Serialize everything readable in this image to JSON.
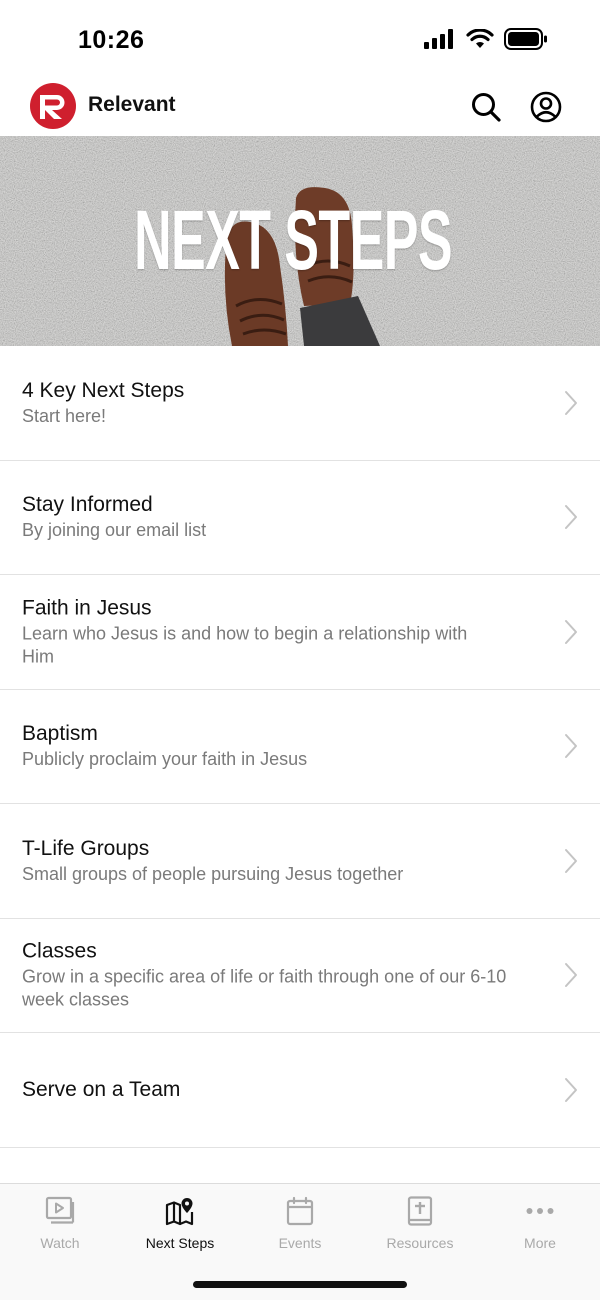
{
  "status_bar": {
    "time": "10:26"
  },
  "header": {
    "app_name": "Relevant",
    "logo_icon": "relevant-r-logo",
    "brand_color": "#cf1f2e",
    "search_icon": "search-icon",
    "profile_icon": "profile-icon"
  },
  "hero": {
    "title": "NEXT STEPS"
  },
  "list": {
    "items": [
      {
        "title": "4 Key Next Steps",
        "subtitle": "Start here!"
      },
      {
        "title": "Stay Informed",
        "subtitle": "By joining our email list"
      },
      {
        "title": "Faith in Jesus",
        "subtitle": "Learn who Jesus is and how to begin a relationship with Him"
      },
      {
        "title": "Baptism",
        "subtitle": "Publicly proclaim your faith in Jesus"
      },
      {
        "title": "T-Life Groups",
        "subtitle": "Small groups of people pursuing Jesus together"
      },
      {
        "title": "Classes",
        "subtitle": "Grow in a specific area of life or faith through one of our 6-10 week classes"
      },
      {
        "title": "Serve on a Team",
        "subtitle": ""
      }
    ]
  },
  "tab_bar": {
    "tabs": [
      {
        "label": "Watch",
        "icon": "play-icon",
        "active": false
      },
      {
        "label": "Next Steps",
        "icon": "map-pin-icon",
        "active": true
      },
      {
        "label": "Events",
        "icon": "calendar-icon",
        "active": false
      },
      {
        "label": "Resources",
        "icon": "bible-icon",
        "active": false
      },
      {
        "label": "More",
        "icon": "more-dots-icon",
        "active": false
      }
    ]
  }
}
